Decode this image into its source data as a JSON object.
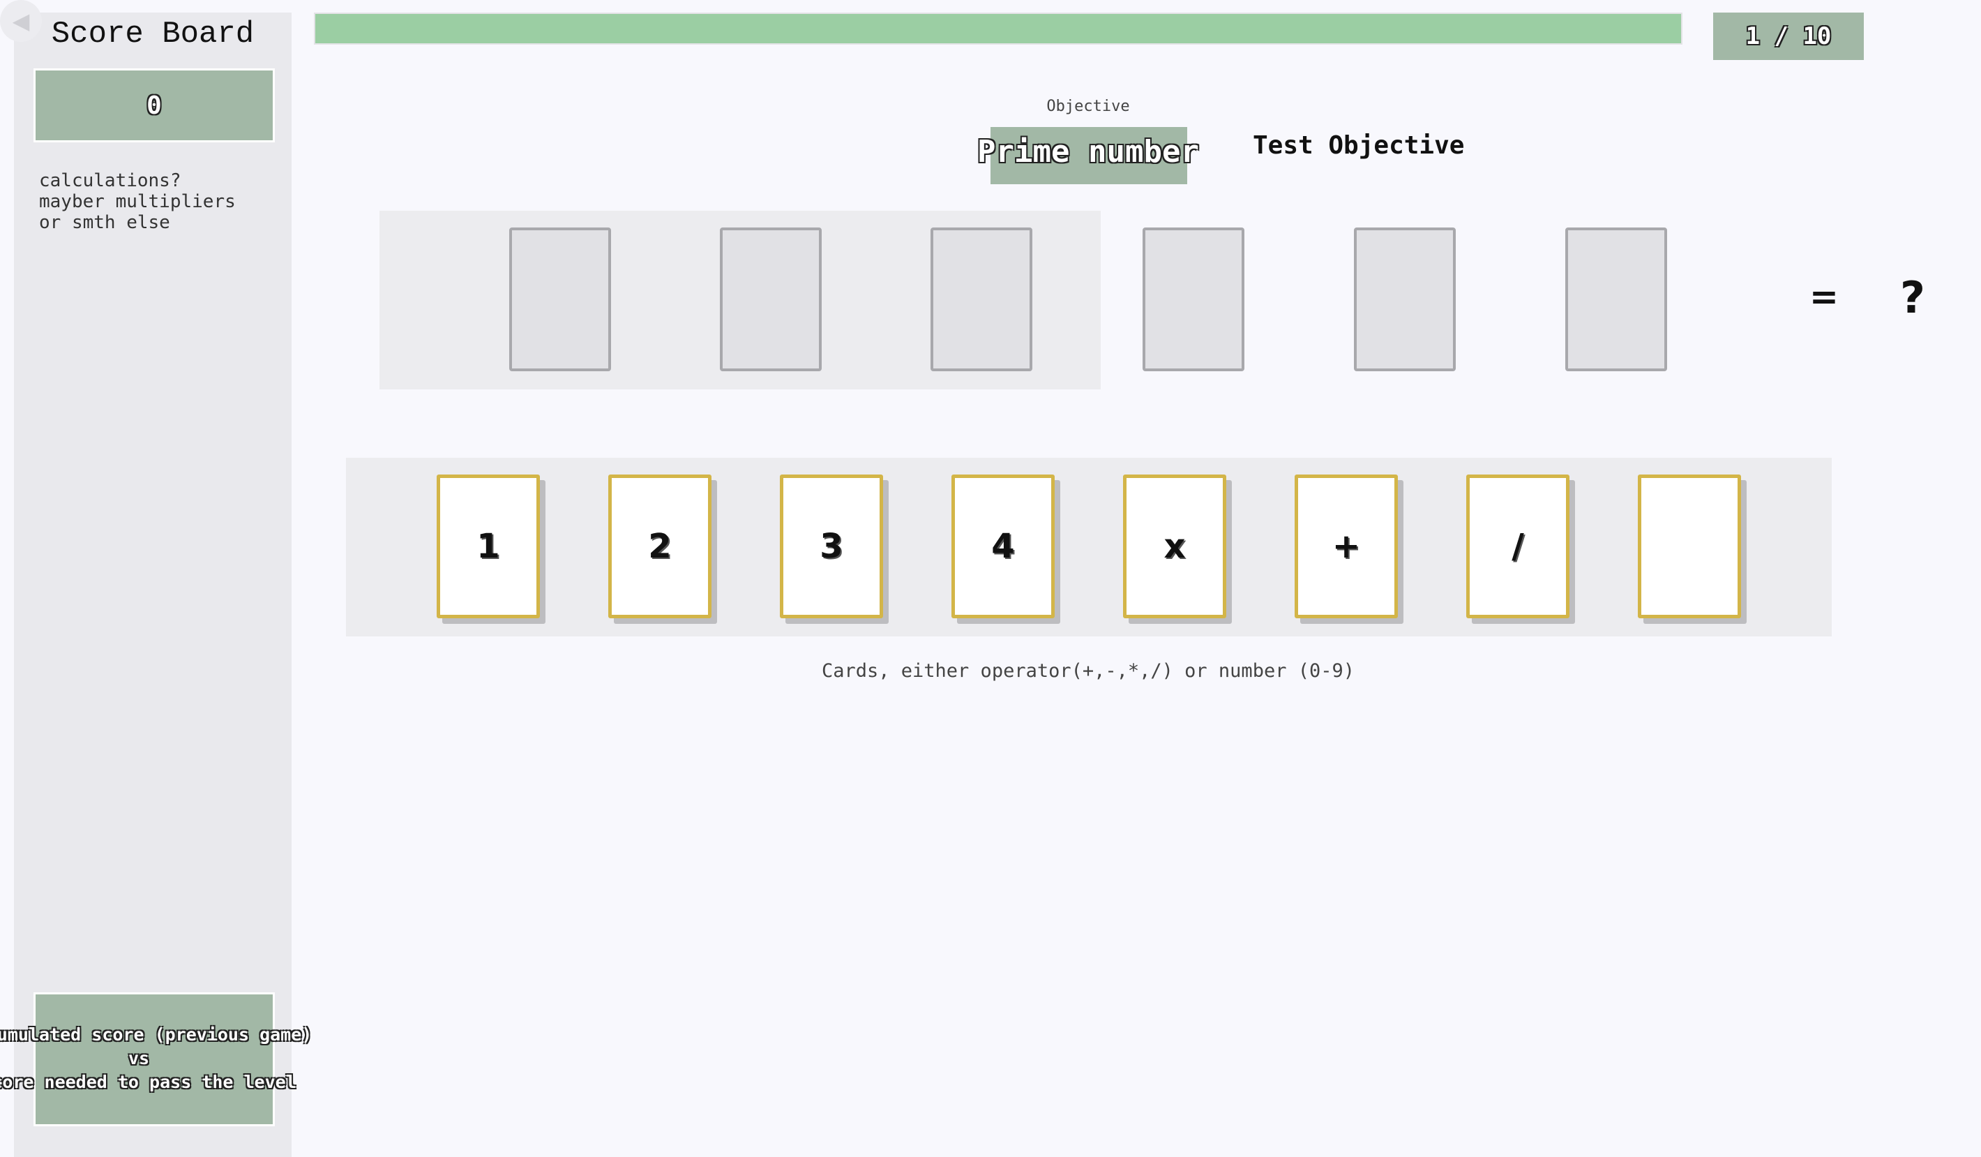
{
  "sidebar": {
    "back_icon": "◀",
    "title": "Score Board",
    "score": "0",
    "note": "calculations?\nmayber multipliers\nor smth else",
    "pass_text": "Accumulated score (previous game)\nvs\nScore needed to pass the level"
  },
  "progress": {
    "fill_fraction": 1.0,
    "color": "#9bcea3"
  },
  "level_counter": "1 / 10",
  "objective": {
    "label": "Objective",
    "value": "Prime number",
    "description": "Test Objective"
  },
  "equation": {
    "slots": [
      "",
      "",
      "",
      "",
      "",
      ""
    ],
    "equals": "=",
    "result": "?"
  },
  "hand": {
    "cards": [
      "1",
      "2",
      "3",
      "4",
      "x",
      "+",
      "/",
      ""
    ],
    "caption": "Cards, either operator(+,-,*,/) or number (0-9)"
  },
  "colors": {
    "panel_green": "#a2b8a6",
    "card_border": "#d3b548",
    "background": "#f8f8fd"
  }
}
